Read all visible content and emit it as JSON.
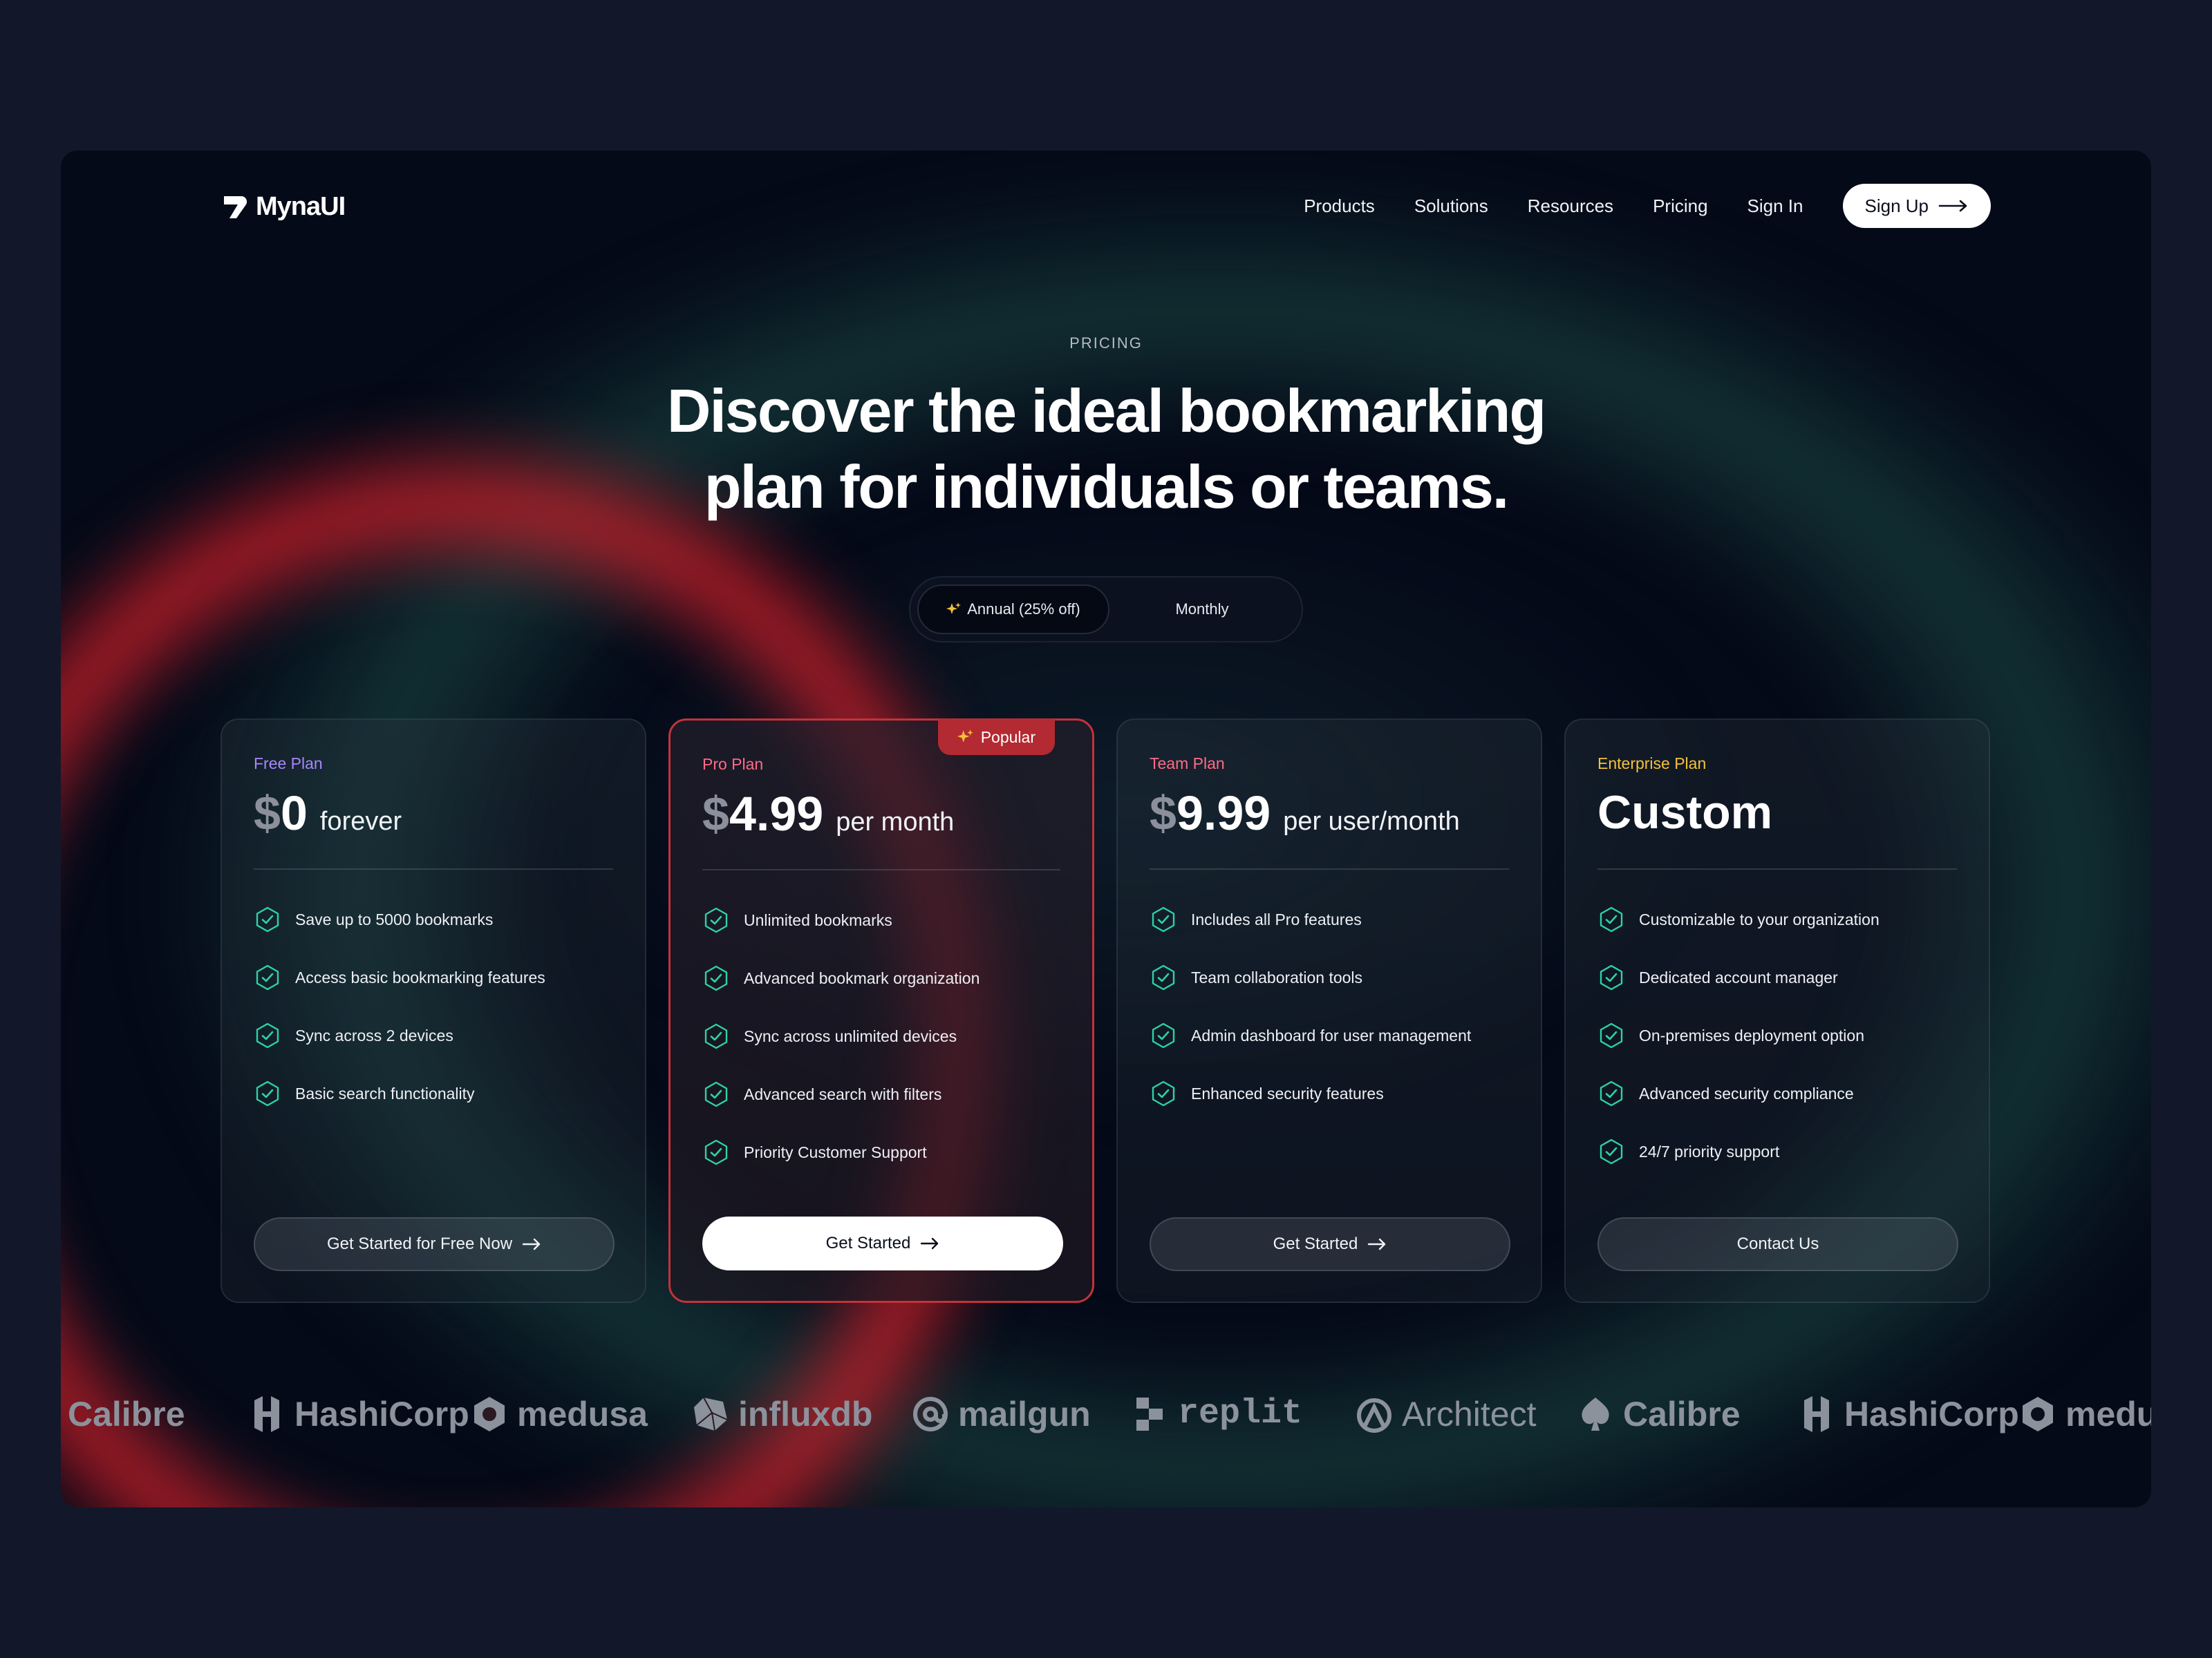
{
  "brand": {
    "name": "MynaUI"
  },
  "nav": {
    "links": [
      "Products",
      "Solutions",
      "Resources",
      "Pricing",
      "Sign In"
    ],
    "signup": "Sign Up"
  },
  "hero": {
    "eyebrow": "PRICING",
    "headline_1": "Discover the ideal bookmarking",
    "headline_2": "plan for individuals or teams."
  },
  "billing_toggle": {
    "annual": "Annual (25% off)",
    "monthly": "Monthly",
    "selected": "annual"
  },
  "plans": [
    {
      "name": "Free Plan",
      "name_color": "#a986ff",
      "currency": "$",
      "amount": "0",
      "period": "forever",
      "features": [
        "Save up to 5000 bookmarks",
        "Access basic bookmarking features",
        "Sync across 2 devices",
        "Basic search functionality"
      ],
      "cta": "Get Started for Free Now"
    },
    {
      "name": "Pro Plan",
      "name_color": "#ff6b86",
      "badge": "Popular",
      "currency": "$",
      "amount": "4.99",
      "period": "per month",
      "features": [
        "Unlimited bookmarks",
        "Advanced bookmark organization",
        "Sync across unlimited devices",
        "Advanced search with filters",
        "Priority Customer Support"
      ],
      "cta": "Get Started"
    },
    {
      "name": "Team Plan",
      "name_color": "#ff6b86",
      "currency": "$",
      "amount": "9.99",
      "period": "per user/month",
      "features": [
        "Includes all Pro features",
        "Team collaboration tools",
        "Admin dashboard for user management",
        "Enhanced security features"
      ],
      "cta": "Get Started"
    },
    {
      "name": "Enterprise Plan",
      "name_color": "#f4c13a",
      "custom_price": "Custom",
      "features": [
        "Customizable to your organization",
        "Dedicated account manager",
        "On-premises deployment option",
        "Advanced security compliance",
        "24/7 priority support"
      ],
      "cta": "Contact Us"
    }
  ],
  "logos": [
    "Calibre",
    "HashiCorp",
    "medusa",
    "influxdb",
    "mailgun",
    "replit",
    "Architect",
    "Calibre",
    "HashiCorp",
    "medu"
  ],
  "colors": {
    "accent_green": "#2fd1a5",
    "pro_border": "#c4323a",
    "badge_bg": "#b42a32"
  }
}
